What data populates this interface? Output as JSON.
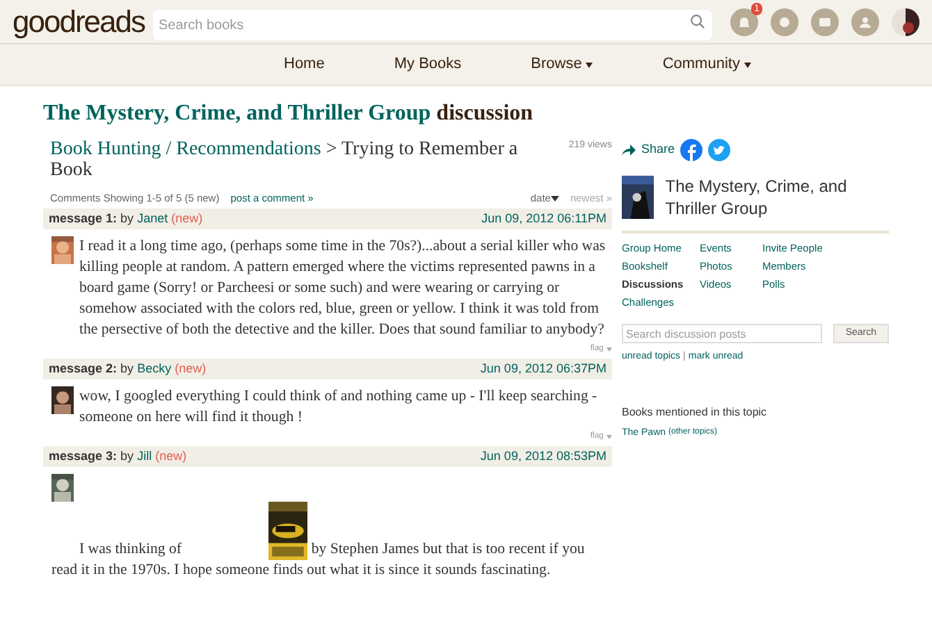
{
  "header": {
    "logo": "goodreads",
    "search": {
      "placeholder": "Search books"
    },
    "notification_count": "1"
  },
  "nav": [
    {
      "label": "Home",
      "dropdown": false
    },
    {
      "label": "My Books",
      "dropdown": false
    },
    {
      "label": "Browse",
      "dropdown": true
    },
    {
      "label": "Community",
      "dropdown": true
    }
  ],
  "title": {
    "group": "The Mystery, Crime, and Thriller Group",
    "suffix": "discussion"
  },
  "breadcrumb": {
    "folder": "Book Hunting / Recommendations",
    "separator": ">",
    "topic": "Trying to Remember a Book",
    "views": "219 views"
  },
  "comments_bar": {
    "count": "Comments Showing 1-5 of 5 (5 new)",
    "post_link": "post a comment »",
    "sort": "date",
    "order": "newest »"
  },
  "messages": [
    {
      "kind": "wrap",
      "label": "message 1:",
      "by": "by",
      "author": "Janet",
      "new": "(new)",
      "date": "Jun 09, 2012 06:11PM",
      "flag": "flag",
      "parts": [
        {
          "kind": "text",
          "text": "I read it a long time ago, (perhaps some time in the 70s?)...about a serial killer who was killing people at random. A pattern emerged where the victims represented pawns in a board game (Sorry! or Parcheesi or some such) and were wearing or carrying or somehow associated with the colors red, blue, green or yellow. I think it was told from the persective of both the detective and the killer. Does that sound familiar to anybody?"
        }
      ]
    },
    {
      "kind": "wrap",
      "label": "message 2:",
      "by": "by",
      "author": "Becky",
      "new": "(new)",
      "date": "Jun 09, 2012 06:37PM",
      "flag": "flag",
      "parts": [
        {
          "kind": "text",
          "text": "wow, I googled everything I could think of and nothing came up - I'll keep searching - someone on here will find it though !"
        }
      ]
    },
    {
      "kind": "stacked",
      "label": "message 3:",
      "by": "by",
      "author": "Jill",
      "new": "(new)",
      "date": "Jun 09, 2012 08:53PM",
      "parts": [
        {
          "kind": "text",
          "text": "I was thinking of"
        },
        {
          "kind": "picture"
        },
        {
          "kind": "text",
          "text": "by Stephen James but that is too recent if you read it in the 1970s. I hope someone finds out what it is since it sounds fascinating."
        }
      ]
    }
  ],
  "sidebar": {
    "share": "Share",
    "group_name": "The Mystery, Crime, and Thriller Group",
    "links": [
      {
        "label": "Group Home",
        "selected": false
      },
      {
        "label": "Events",
        "selected": false
      },
      {
        "label": "Invite People",
        "selected": false
      },
      {
        "label": "Bookshelf",
        "selected": false
      },
      {
        "label": "Photos",
        "selected": false
      },
      {
        "label": "Members",
        "selected": false
      },
      {
        "label": "Discussions",
        "selected": true
      },
      {
        "label": "Videos",
        "selected": false
      },
      {
        "label": "Polls",
        "selected": false
      },
      {
        "label": "Challenges",
        "selected": false
      }
    ],
    "search": {
      "placeholder": "Search discussion posts",
      "button": "Search"
    },
    "unread": "unread topics",
    "unread_separator": "|",
    "mark_unread": "mark unread",
    "books_heading": "Books mentioned in this topic",
    "book": "The Pawn",
    "other_topics": "(other topics)"
  }
}
